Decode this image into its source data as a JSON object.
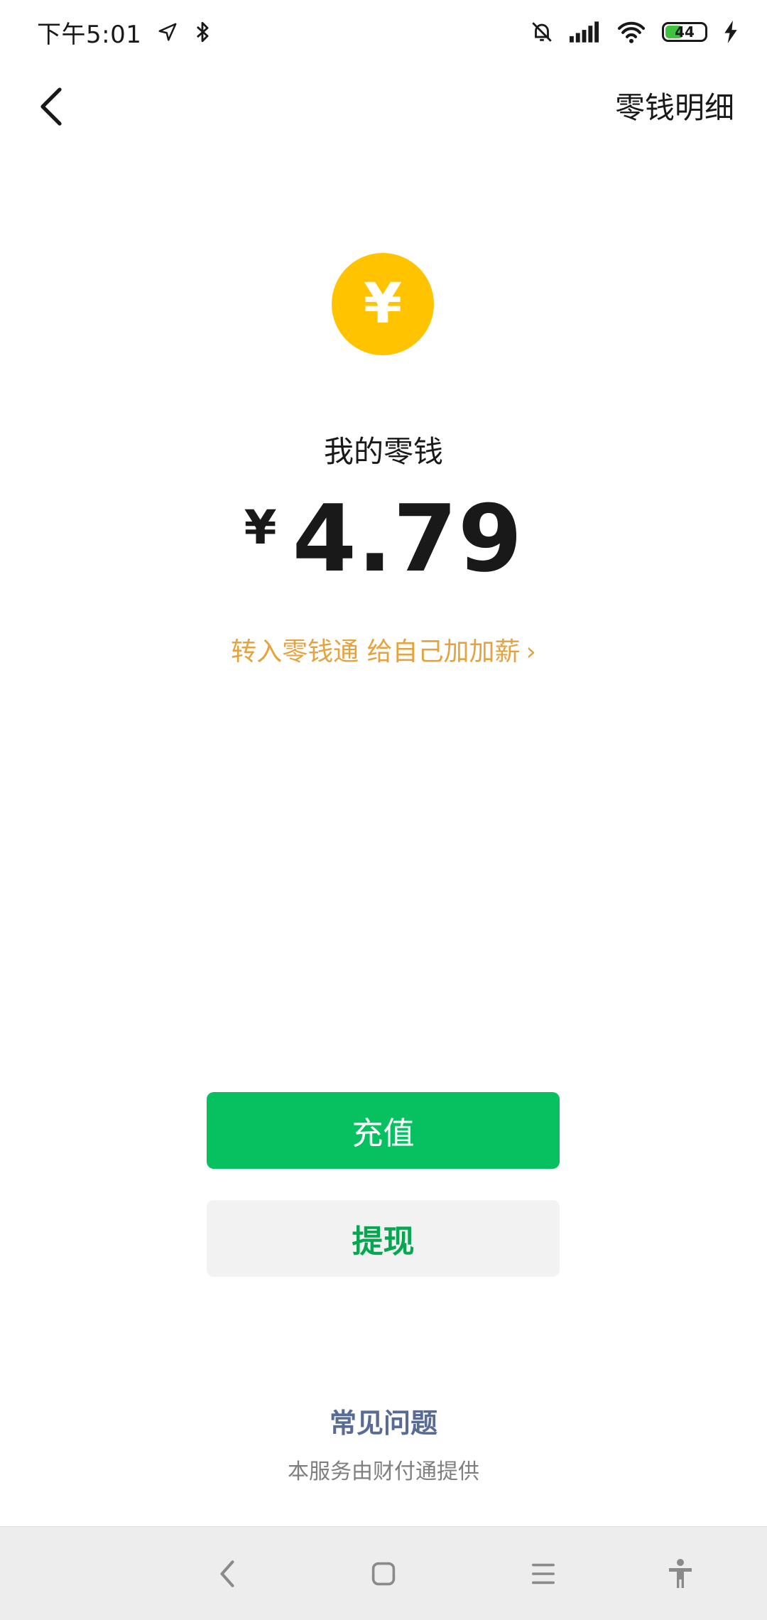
{
  "status_bar": {
    "time": "下午5:01",
    "battery": "44",
    "battery_level": 0.44,
    "icons": [
      "location-arrow-icon",
      "bluetooth-icon",
      "mute-bell-icon",
      "signal-icon",
      "wifi-icon",
      "battery-icon",
      "charging-icon"
    ]
  },
  "header": {
    "back_icon": "chevron-left-icon",
    "detail_label": "零钱明细"
  },
  "wallet": {
    "coin_symbol": "¥",
    "title": "我的零钱",
    "currency": "¥",
    "amount": "4.79",
    "promo": "转入零钱通 给自己加加薪",
    "promo_chevron": "›"
  },
  "actions": {
    "recharge": "充值",
    "withdraw": "提现"
  },
  "footer": {
    "faq": "常见问题",
    "provider": "本服务由财付通提供"
  },
  "system_nav": {
    "icons": [
      "nav-back-icon",
      "nav-home-icon",
      "nav-menu-icon",
      "accessibility-icon"
    ]
  },
  "colors": {
    "coin": "#ffc300",
    "primary_button": "#07c160",
    "secondary_button_bg": "#f2f2f2",
    "secondary_button_text": "#07a650",
    "promo_text": "#e6a23c",
    "faq_text": "#576b95"
  }
}
